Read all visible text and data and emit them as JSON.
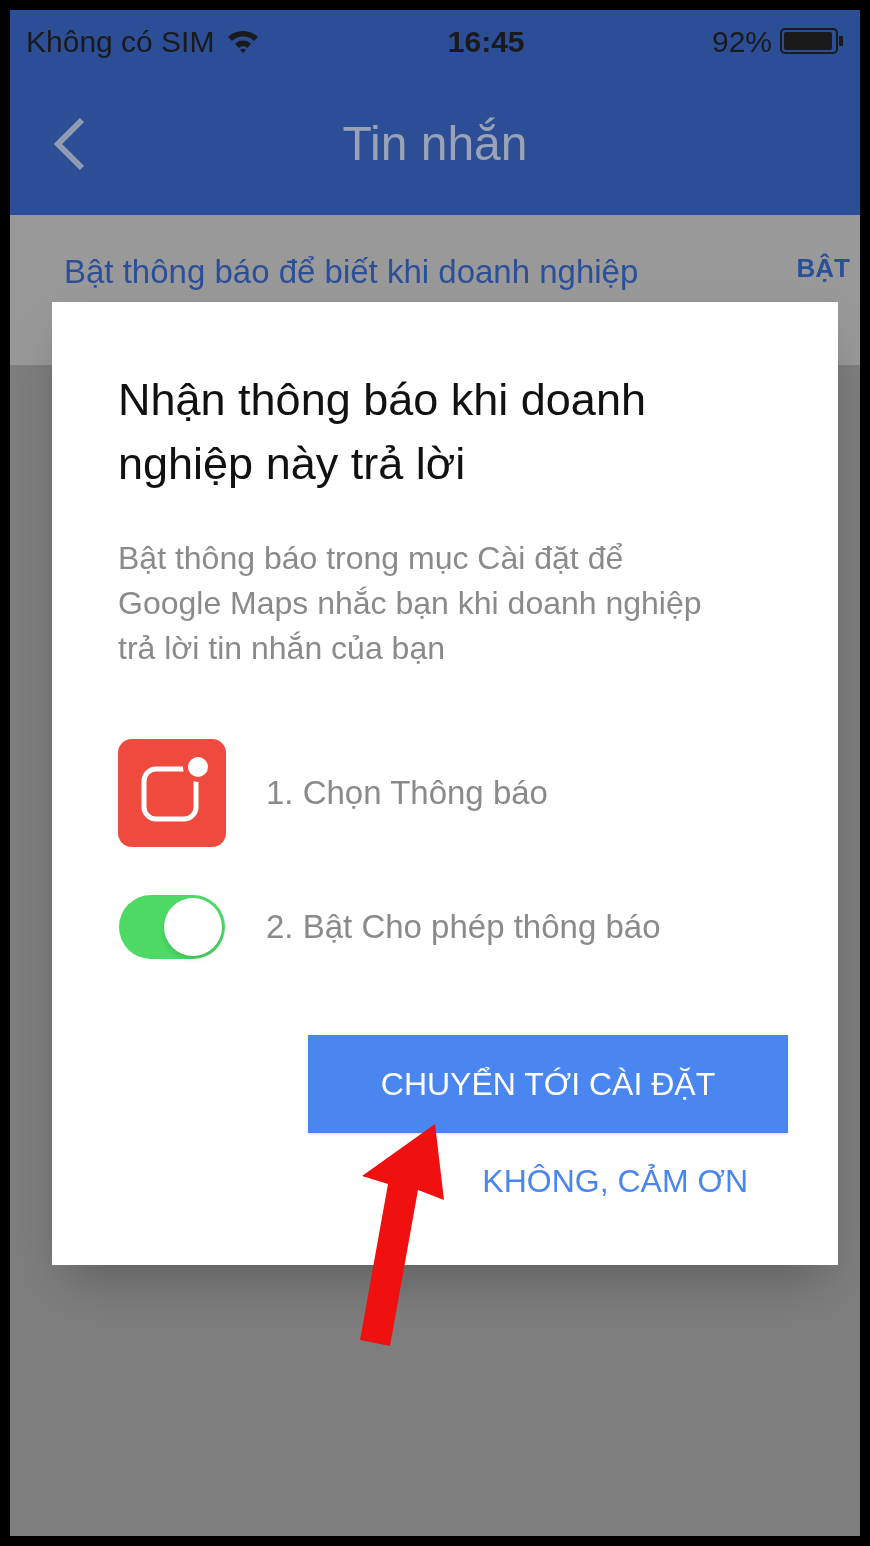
{
  "status_bar": {
    "carrier": "Không có SIM",
    "time": "16:45",
    "battery": "92%"
  },
  "header": {
    "title": "Tin nhắn"
  },
  "banner": {
    "text": "Bật thông báo để biết khi doanh nghiệp",
    "action": "BẬT"
  },
  "dialog": {
    "title": "Nhận thông báo khi doanh nghiệp này trả lời",
    "body": "Bật thông báo trong mục Cài đặt để Google Maps nhắc bạn khi doanh nghiệp trả lời tin nhắn của bạn",
    "steps": [
      {
        "kind": "app-icon",
        "label": "1. Chọn Thông báo"
      },
      {
        "kind": "toggle",
        "on": true,
        "label": "2. Bật Cho phép thông báo"
      }
    ],
    "primary_button": "CHUYỂN TỚI CÀI ĐẶT",
    "secondary_button": "KHÔNG, CẢM ƠN"
  }
}
